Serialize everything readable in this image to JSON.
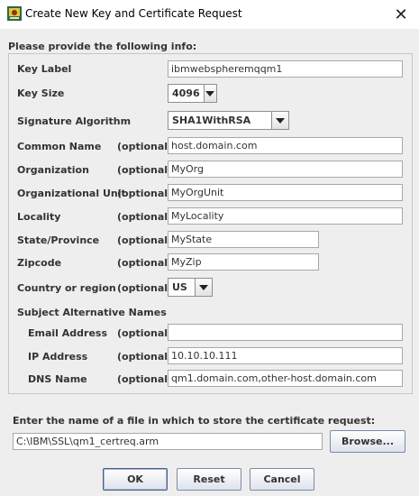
{
  "window": {
    "title": "Create New Key and Certificate Request",
    "close_label": "✕"
  },
  "section_title": "Please provide the following info:",
  "fields": {
    "key_label": {
      "label": "Key Label",
      "value": "ibmwebspheremqqm1"
    },
    "key_size": {
      "label": "Key Size",
      "value": "4096"
    },
    "signature_algorithm": {
      "label": "Signature Algorithm",
      "value": "SHA1WithRSA"
    },
    "common_name": {
      "label": "Common Name",
      "optional": "(optional)",
      "value": "host.domain.com"
    },
    "organization": {
      "label": "Organization",
      "optional": "(optional)",
      "value": "MyOrg"
    },
    "organizational_unit": {
      "label": "Organizational Unit",
      "optional": "(optional)",
      "value": "MyOrgUnit"
    },
    "locality": {
      "label": "Locality",
      "optional": "(optional)",
      "value": "MyLocality"
    },
    "state_province": {
      "label": "State/Province",
      "optional": "(optional)",
      "value": "MyState"
    },
    "zipcode": {
      "label": "Zipcode",
      "optional": "(optional)",
      "value": "MyZip"
    },
    "country": {
      "label": "Country or region",
      "optional": "(optional)",
      "value": "US"
    }
  },
  "san": {
    "heading": "Subject Alternative Names",
    "email": {
      "label": "Email Address",
      "optional": "(optional)",
      "value": ""
    },
    "ip": {
      "label": "IP Address",
      "optional": "(optional)",
      "value": "10.10.10.111"
    },
    "dns": {
      "label": "DNS Name",
      "optional": "(optional)",
      "value": "qm1.domain.com,other-host.domain.com"
    }
  },
  "file": {
    "label": "Enter the name of a file in which to store the certificate request:",
    "value": "C:\\IBM\\SSL\\qm1_certreq.arm",
    "browse_label": "Browse..."
  },
  "buttons": {
    "ok": "OK",
    "reset": "Reset",
    "cancel": "Cancel"
  },
  "colors": {
    "background": "#eeeeee",
    "titlebar": "#ffffff",
    "button_border": "#7a8ba5"
  }
}
